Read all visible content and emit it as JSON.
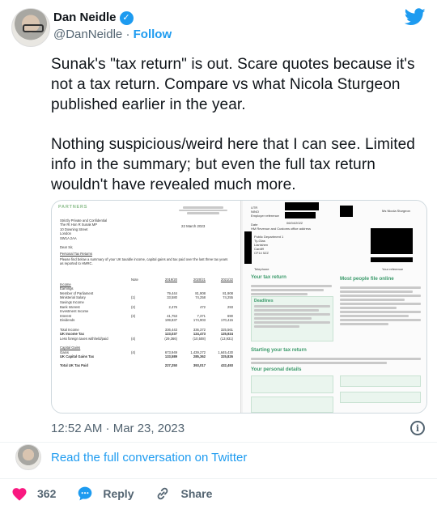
{
  "author": {
    "display_name": "Dan Neidle",
    "handle": "@DanNeidle",
    "separator": "·",
    "follow_label": "Follow"
  },
  "tweet": {
    "paragraph_1": "Sunak's \"tax return\" is out. Scare quotes because it's not a tax return. Compare vs what Nicola Sturgeon published earlier in the year.",
    "paragraph_2": "Nothing suspicious/weird here that I can see. Limited info in the summary; but even the full tax return wouldn't have revealed much more."
  },
  "media": {
    "left_doc": {
      "logo": "PARTNERS",
      "date": "22 March 2023",
      "address": [
        "Strictly Private and Confidential",
        "The Rt Hon R Sunak MP",
        "10 Downing Street",
        "London",
        "SW1A 2AA"
      ],
      "salutation": "Dear Sir,",
      "heading": "Personal Tax Returns",
      "intro": "Please find below a summary of your UK taxable income, capital gains and tax paid over the last three tax years as reported to HMRC.",
      "columns": [
        "Note",
        "2019/20",
        "2020/21",
        "2021/22"
      ],
      "rows": [
        {
          "label": "Income",
          "note": "",
          "v1": "",
          "v2": "",
          "v3": "",
          "style": "ul"
        },
        {
          "label": "Earnings",
          "note": "",
          "v1": "",
          "v2": "",
          "v3": "",
          "style": ""
        },
        {
          "label": "Member of Parliament",
          "note": "",
          "v1": "79,444",
          "v2": "81,908",
          "v3": "81,908",
          "style": ""
        },
        {
          "label": "Ministerial Salary",
          "note": "(1)",
          "v1": "33,580",
          "v2": "74,258",
          "v3": "74,255",
          "style": ""
        },
        {
          "label": "Savings Income",
          "note": "",
          "v1": "",
          "v2": "",
          "v3": "",
          "style": ""
        },
        {
          "label": "Bank Interest",
          "note": "(2)",
          "v1": "2,476",
          "v2": "472",
          "v3": "293",
          "style": ""
        },
        {
          "label": "Investment Income",
          "note": "",
          "v1": "",
          "v2": "",
          "v3": "",
          "style": ""
        },
        {
          "label": "Interest",
          "note": "(3)",
          "v1": "41,753",
          "v2": "7,371",
          "v3": "690",
          "style": ""
        },
        {
          "label": "Dividends",
          "note": "",
          "v1": "199,837",
          "v2": "174,903",
          "v3": "170,415",
          "style": ""
        },
        {
          "label": "",
          "note": "",
          "v1": "",
          "v2": "",
          "v3": "",
          "style": ""
        },
        {
          "label": "Total Income",
          "note": "",
          "v1": "336,443",
          "v2": "336,372",
          "v3": "325,561",
          "style": ""
        },
        {
          "label": "UK Income Tax",
          "note": "",
          "v1": "123,037",
          "v2": "124,473",
          "v3": "125,924",
          "style": "bold"
        },
        {
          "label": "Less foreign taxes withheld/paid",
          "note": "(4)",
          "v1": "(29,366)",
          "v2": "(10,508)",
          "v3": "(13,931)",
          "style": ""
        },
        {
          "label": "",
          "note": "",
          "v1": "",
          "v2": "",
          "v3": "",
          "style": ""
        },
        {
          "label": "Capital Gains",
          "note": "",
          "v1": "",
          "v2": "",
          "v3": "",
          "style": "ul"
        },
        {
          "label": "Gains",
          "note": "(4)",
          "v1": "673,949",
          "v2": "1,439,272",
          "v3": "1,645,430",
          "style": ""
        },
        {
          "label": "UK Capital Gains Tax",
          "note": "",
          "v1": "133,589",
          "v2": "285,362",
          "v3": "325,826",
          "style": "bold"
        },
        {
          "label": "",
          "note": "",
          "v1": "",
          "v2": "",
          "v3": "",
          "style": ""
        },
        {
          "label": "Total UK Tax Paid",
          "note": "",
          "v1": "227,250",
          "v2": "393,017",
          "v3": "432,493",
          "style": "bold"
        }
      ]
    },
    "right_doc": {
      "header_left": [
        "UTR",
        "NINO",
        "Employer reference",
        "Date",
        "HM Revenue and Customs office address"
      ],
      "date": "06/04/2022",
      "recipient": "Ms Nicola Sturgeon",
      "office": [
        "Public Department 1",
        "Ty-Glas",
        "Llanishen",
        "Cardiff",
        "CF14 5ZZ"
      ],
      "telephone": "Telephone",
      "reference": "Your reference",
      "section_title": "Your tax return",
      "deadlines": "Deadlines",
      "online_title": "Most people file online",
      "start_title": "Starting your tax return",
      "personal_title": "Your personal details"
    }
  },
  "timestamp": "12:52 AM · Mar 23, 2023",
  "conversation_link": "Read the full conversation on Twitter",
  "actions": {
    "like_count": "362",
    "reply_label": "Reply",
    "share_label": "Share"
  },
  "colors": {
    "accent": "#1d9bf0",
    "like": "#f91880",
    "text": "#0f1419",
    "muted": "#536471"
  }
}
